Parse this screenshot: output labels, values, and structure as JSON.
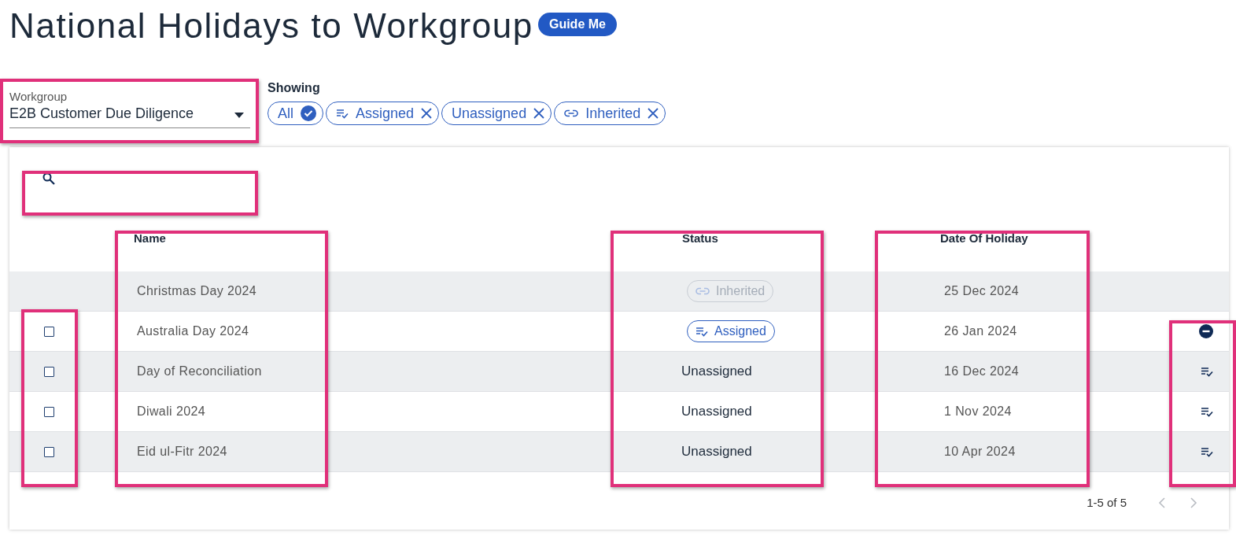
{
  "title": "National Holidays to Workgroup",
  "guide_button": "Guide Me",
  "workgroup": {
    "label": "Workgroup",
    "value": "E2B Customer Due Diligence"
  },
  "showing": {
    "label": "Showing",
    "chips": [
      {
        "label": "All",
        "kind": "all",
        "selected": true
      },
      {
        "label": "Assigned",
        "kind": "assigned",
        "selected": false
      },
      {
        "label": "Unassigned",
        "kind": "unassigned",
        "selected": false
      },
      {
        "label": "Inherited",
        "kind": "inherited",
        "selected": false
      }
    ]
  },
  "table": {
    "columns": [
      "Name",
      "Status",
      "Date Of Holiday"
    ],
    "rows": [
      {
        "name": "Christmas Day 2024",
        "status": {
          "label": "Inherited",
          "kind": "inherited"
        },
        "date": "25 Dec 2024"
      },
      {
        "checkbox": {
          "checked": false
        },
        "name": "Australia Day 2024",
        "status": {
          "label": "Assigned",
          "kind": "assigned"
        },
        "date": "26 Jan 2024",
        "action": {
          "kind": "remove"
        }
      },
      {
        "checkbox": {
          "checked": false
        },
        "name": "Day of Reconciliation",
        "status": {
          "label": "Unassigned",
          "kind": "unassigned"
        },
        "date": "16 Dec 2024",
        "action": {
          "kind": "assign"
        }
      },
      {
        "checkbox": {
          "checked": false
        },
        "name": "Diwali 2024",
        "status": {
          "label": "Unassigned",
          "kind": "unassigned"
        },
        "date": "1 Nov 2024",
        "action": {
          "kind": "assign"
        }
      },
      {
        "checkbox": {
          "checked": false
        },
        "name": "Eid ul-Fitr 2024",
        "status": {
          "label": "Unassigned",
          "kind": "unassigned"
        },
        "date": "10 Apr 2024",
        "action": {
          "kind": "assign"
        }
      }
    ]
  },
  "pagination": {
    "range": "1-5 of 5",
    "prev_disabled": true,
    "next_disabled": true
  }
}
